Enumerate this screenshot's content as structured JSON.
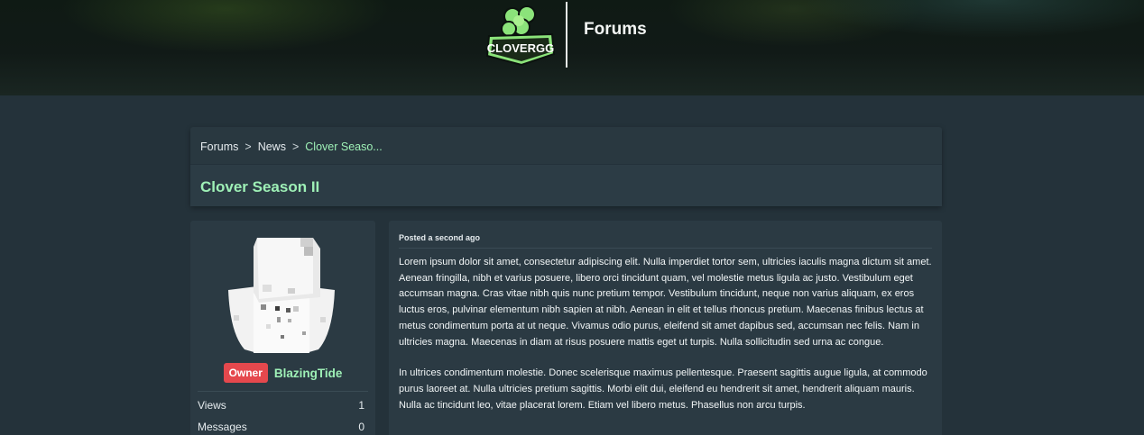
{
  "header": {
    "logo_text": "CLOVERGG",
    "title": "Forums"
  },
  "breadcrumb": {
    "items": [
      "Forums",
      "News",
      "Clover Seaso..."
    ],
    "separator": ">"
  },
  "thread": {
    "title": "Clover Season II"
  },
  "author": {
    "rank": "Owner",
    "username": "BlazingTide",
    "stats": [
      {
        "label": "Views",
        "value": "1"
      },
      {
        "label": "Messages",
        "value": "0"
      }
    ]
  },
  "post": {
    "meta": "Posted a second ago",
    "paragraphs": [
      "Lorem ipsum dolor sit amet, consectetur adipiscing elit. Nulla imperdiet tortor sem, ultricies iaculis magna dictum sit amet. Aenean fringilla, nibh et varius posuere, libero orci tincidunt quam, vel molestie metus ligula ac justo. Vestibulum eget accumsan magna. Cras vitae nibh quis nunc pretium tempor. Vestibulum tincidunt, neque non varius aliquam, ex eros luctus eros, pulvinar elementum nibh sapien at nibh. Aenean in elit et tellus rhoncus pretium. Maecenas finibus lectus at metus condimentum porta at ut neque. Vivamus odio purus, eleifend sit amet dapibus sed, accumsan nec felis. Nam in ultricies magna. Maecenas in diam at risus posuere mattis eget ut turpis. Nulla sollicitudin sed urna ac congue.",
      "In ultrices condimentum molestie. Donec scelerisque maximus pellentesque. Praesent sagittis augue ligula, at commodo purus laoreet at. Nulla ultricies pretium sagittis. Morbi elit dui, eleifend eu hendrerit sit amet, hendrerit aliquam mauris. Nulla ac tincidunt leo, vitae placerat lorem. Etiam vel libero metus. Phasellus non arcu turpis."
    ]
  },
  "colors": {
    "accent": "#9ef0b6",
    "rank_badge": "#e5484d",
    "panel": "#2b3a43",
    "page_bg": "#24323a"
  }
}
